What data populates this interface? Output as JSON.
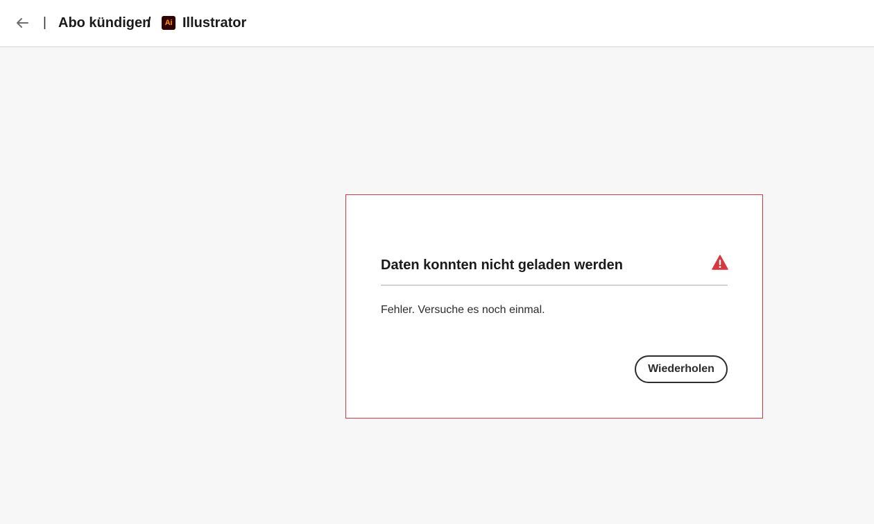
{
  "header": {
    "back_icon": "arrow-left-icon",
    "separator": "|",
    "breadcrumb_title": "Abo kündigen",
    "breadcrumb_slash": "/",
    "app_logo_text": "Ai",
    "app_logo_bg": "#330000",
    "app_logo_fg": "#ff9a00",
    "app_name": "Illustrator"
  },
  "error_card": {
    "title": "Daten konnten nicht geladen werden",
    "icon": "alert-triangle-icon",
    "accent_color": "#d7373f",
    "message": "Fehler. Versuche es noch einmal.",
    "retry_label": "Wiederholen"
  }
}
